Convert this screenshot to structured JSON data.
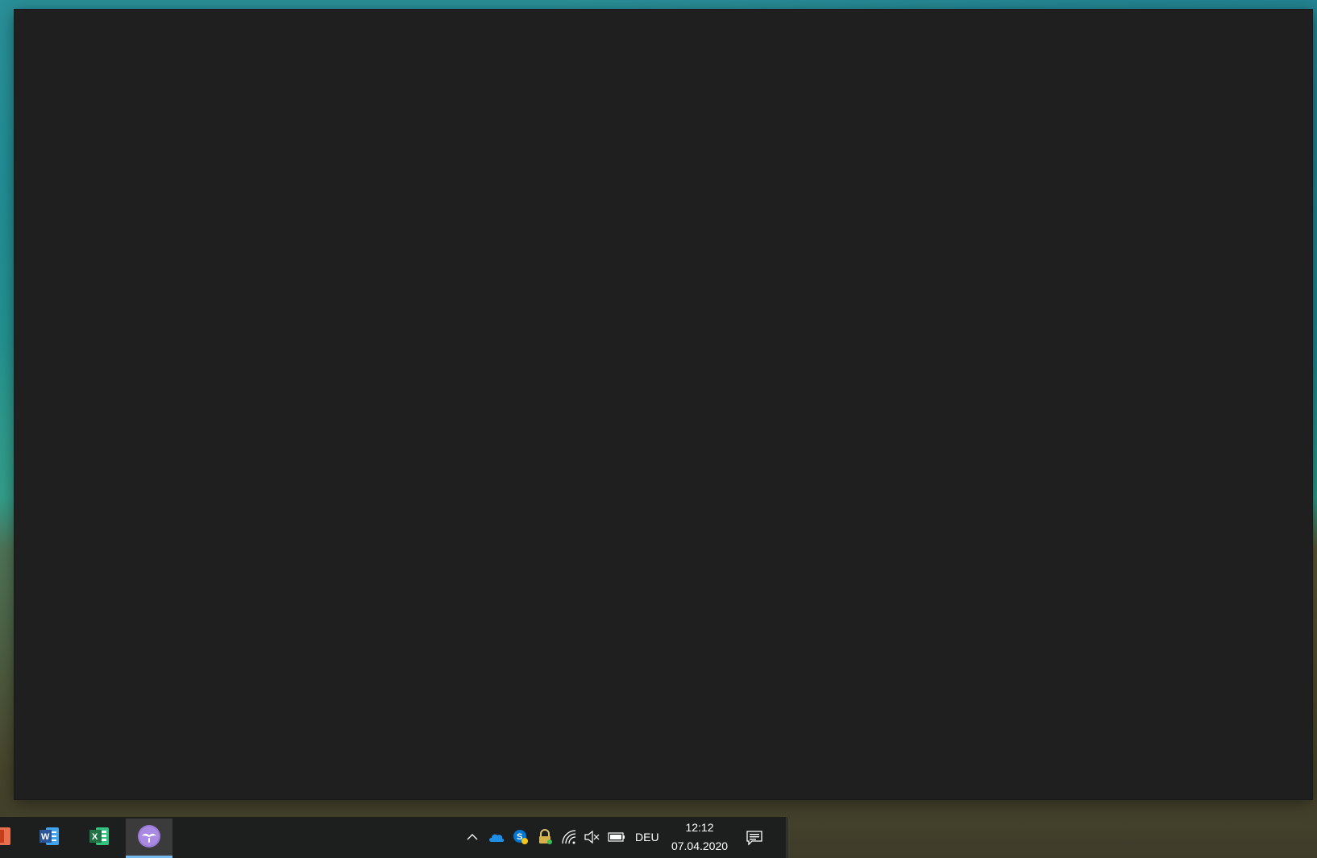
{
  "window": {
    "title": "",
    "background": "#1f1f1f"
  },
  "taskbar": {
    "pinned_apps": [
      {
        "name": "PowerPoint",
        "icon": "powerpoint-icon",
        "color": "#c43e1c"
      },
      {
        "name": "Word",
        "icon": "word-icon",
        "color": "#2b579a",
        "letter": "W"
      },
      {
        "name": "Excel",
        "icon": "excel-icon",
        "color": "#217346",
        "letter": "X"
      },
      {
        "name": "Active app",
        "icon": "mustache-app-icon",
        "color": "#9b7bd8",
        "active": true
      }
    ],
    "tray": {
      "language": "DEU",
      "time": "12:12",
      "date": "07.04.2020",
      "icons": [
        "chevron-up-icon",
        "onedrive-icon",
        "skype-icon",
        "vpn-lock-icon",
        "wifi-icon",
        "volume-muted-icon",
        "battery-icon",
        "notifications-icon"
      ]
    },
    "accent_color": "#76b9ed"
  }
}
